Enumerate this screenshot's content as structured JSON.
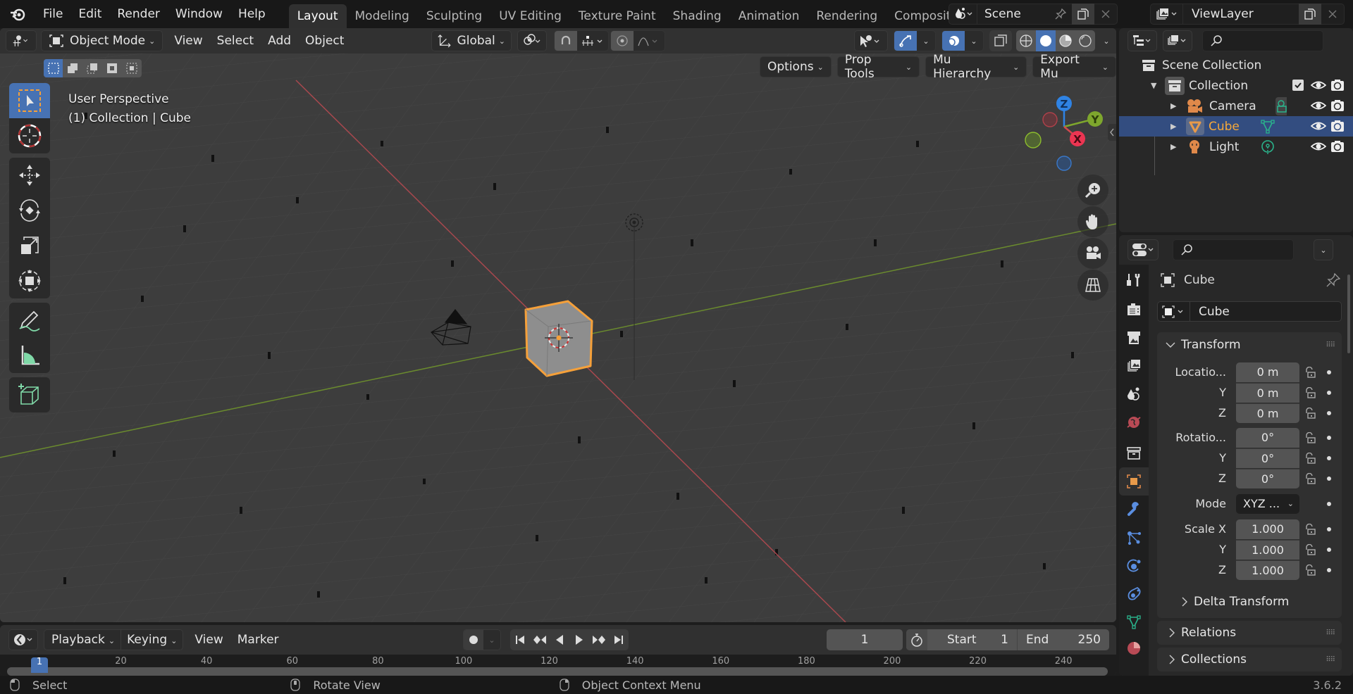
{
  "topbar": {
    "menus": [
      "File",
      "Edit",
      "Render",
      "Window",
      "Help"
    ],
    "workspaces": [
      "Layout",
      "Modeling",
      "Sculpting",
      "UV Editing",
      "Texture Paint",
      "Shading",
      "Animation",
      "Rendering",
      "Compositing"
    ],
    "active_workspace": "Layout",
    "scene_name": "Scene",
    "view_layer_name": "ViewLayer"
  },
  "viewport": {
    "mode": "Object Mode",
    "menus": [
      "View",
      "Select",
      "Add",
      "Object"
    ],
    "transform_orientation": "Global",
    "addon_menus": [
      "Options",
      "Prop Tools",
      "Mu Hierarchy",
      "Export Mu"
    ],
    "overlay_line1": "User Perspective",
    "overlay_line2": "(1) Collection | Cube",
    "gizmo_axes": {
      "x": "X",
      "y": "Y",
      "z": "Z"
    },
    "shading_mode": "Solid",
    "colors": {
      "background": "#3d3d3d",
      "x_axis": "#d2484f",
      "y_axis": "#7ea72d",
      "z_axis": "#2f83e4",
      "selection": "#f5a03a",
      "active_tool": "#4772b3"
    }
  },
  "outliner": {
    "root": "Scene Collection",
    "collection": "Collection",
    "items": [
      {
        "name": "Camera",
        "type": "camera",
        "selected": false
      },
      {
        "name": "Cube",
        "type": "mesh",
        "selected": true
      },
      {
        "name": "Light",
        "type": "light",
        "selected": false
      }
    ]
  },
  "properties": {
    "object_name": "Cube",
    "datablock_name": "Cube",
    "transform_title": "Transform",
    "location_label": "Locatio...",
    "rotation_label": "Rotatio...",
    "scale_label": "Scale X",
    "mode_label": "Mode",
    "y_label": "Y",
    "z_label": "Z",
    "location": [
      "0 m",
      "0 m",
      "0 m"
    ],
    "rotation": [
      "0°",
      "0°",
      "0°"
    ],
    "rotation_mode": "XYZ ...",
    "scale": [
      "1.000",
      "1.000",
      "1.000"
    ],
    "subpanels": [
      "Delta Transform"
    ],
    "panels": [
      "Relations",
      "Collections"
    ]
  },
  "timeline": {
    "menus": [
      "Playback",
      "Keying",
      "View",
      "Marker"
    ],
    "current_frame": "1",
    "start_label": "Start",
    "start": "1",
    "end_label": "End",
    "end": "250",
    "ruler_ticks": [
      "20",
      "40",
      "60",
      "80",
      "100",
      "120",
      "140",
      "160",
      "180",
      "200",
      "220",
      "240"
    ],
    "playhead": "1"
  },
  "statusbar": {
    "hints": [
      "Select",
      "Rotate View",
      "Object Context Menu"
    ],
    "version": "3.6.2"
  }
}
